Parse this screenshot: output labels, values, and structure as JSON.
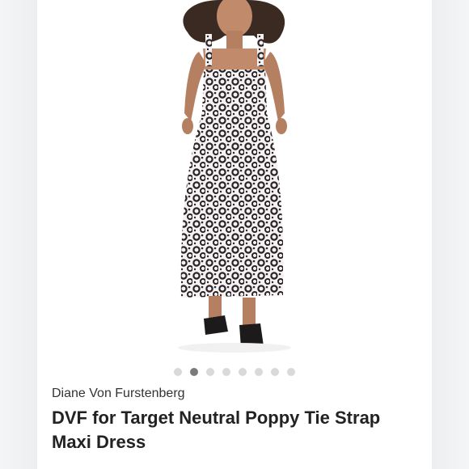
{
  "listing": {
    "brand": "Diane Von Furstenberg",
    "title": "DVF for Target Neutral Poppy Tie Strap Maxi Dress"
  },
  "carousel": {
    "total_images": 8,
    "active_index": 1
  },
  "colors": {
    "active_dot": "#7a7a7a",
    "inactive_dot": "#d9d9d9",
    "dress_base": "#ffffff",
    "dress_pattern": "#2b2226"
  }
}
